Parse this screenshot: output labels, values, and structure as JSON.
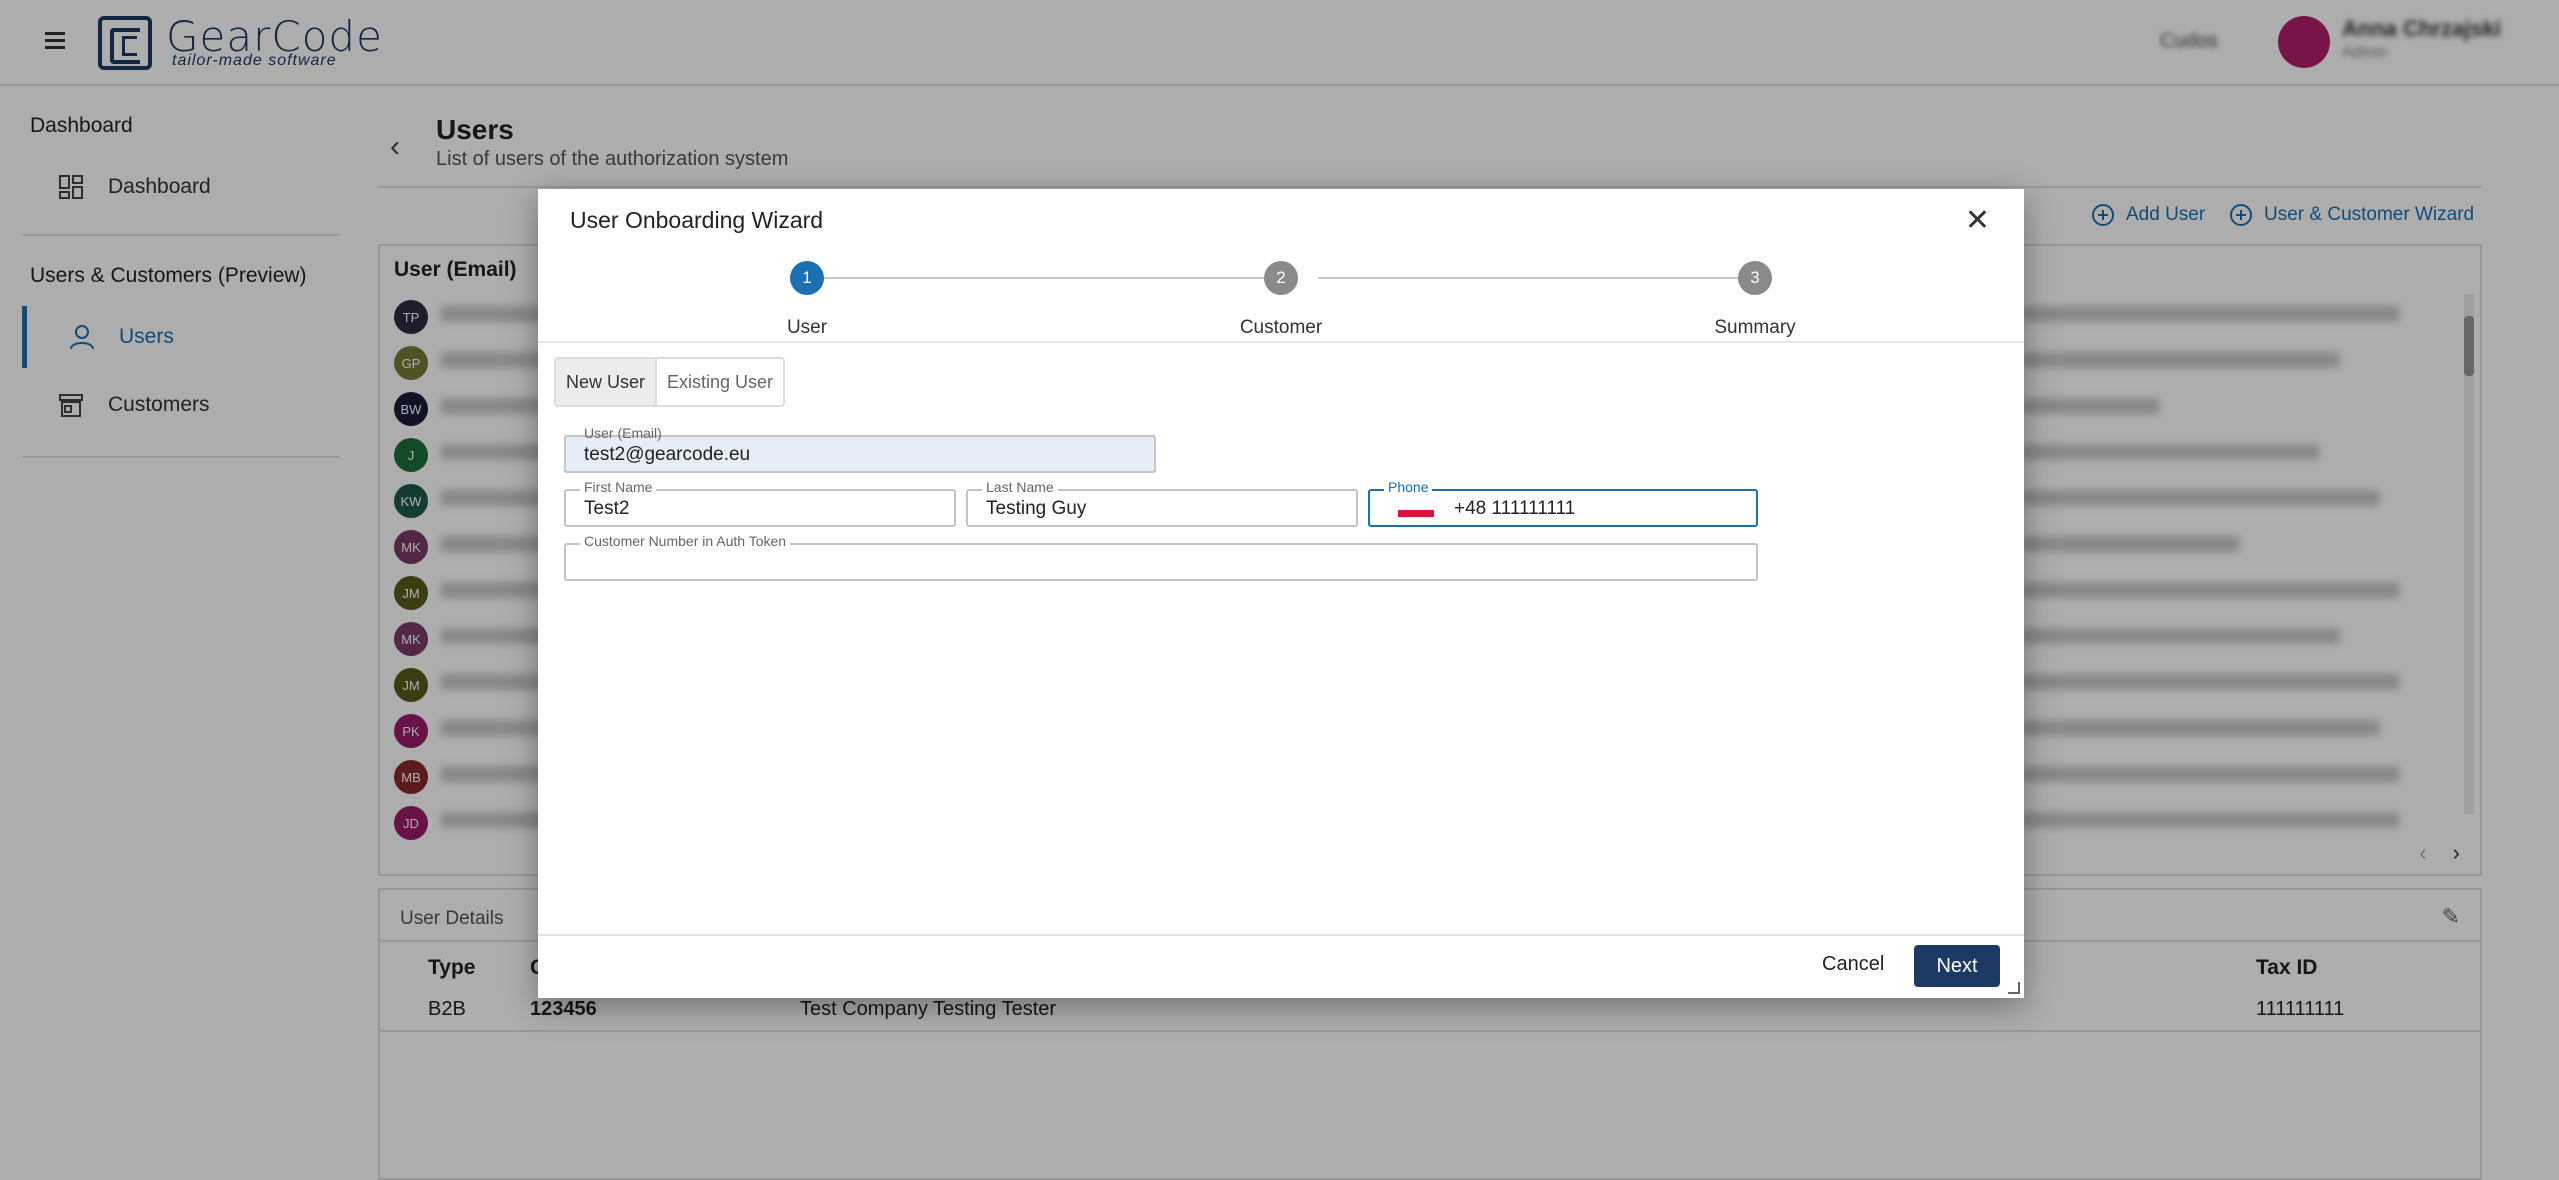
{
  "app": {
    "brand": "GearCode",
    "tagline": "tailor-made software"
  },
  "topbar": {
    "right_text": "Cudos",
    "user_name": "Anna Chrzajski",
    "user_sub": "Admin"
  },
  "sidebar": {
    "section1": "Dashboard",
    "item_dashboard": "Dashboard",
    "section2": "Users & Customers (Preview)",
    "item_users": "Users",
    "item_customers": "Customers"
  },
  "page": {
    "title": "Users",
    "subtitle": "List of users of the authorization system"
  },
  "actions": {
    "add_user": "Add User",
    "wizard": "User & Customer Wizard"
  },
  "table": {
    "header": "User (Email)",
    "avatars": [
      {
        "initials": "TP",
        "color": "#2c2c44"
      },
      {
        "initials": "GP",
        "color": "#7a7a3a"
      },
      {
        "initials": "BW",
        "color": "#1c1c3c"
      },
      {
        "initials": "J",
        "color": "#1c6e3a"
      },
      {
        "initials": "KW",
        "color": "#1c5a4a"
      },
      {
        "initials": "MK",
        "color": "#7a3a6a"
      },
      {
        "initials": "JM",
        "color": "#5a5a1c"
      },
      {
        "initials": "MK",
        "color": "#7a3a6a"
      },
      {
        "initials": "JM",
        "color": "#5a5a1c"
      },
      {
        "initials": "PK",
        "color": "#9a1c6a"
      },
      {
        "initials": "MB",
        "color": "#8a2a2a"
      },
      {
        "initials": "JD",
        "color": "#9a1c6a"
      }
    ]
  },
  "details": {
    "tab": "User Details",
    "columns": {
      "type": "Type",
      "code": "C",
      "tax": "Tax ID"
    },
    "row": {
      "type": "B2B",
      "code": "123456",
      "name": "Test Company Testing Tester",
      "tax": "111111111"
    }
  },
  "dialog": {
    "title": "User Onboarding Wizard",
    "steps": [
      {
        "num": "1",
        "label": "User"
      },
      {
        "num": "2",
        "label": "Customer"
      },
      {
        "num": "3",
        "label": "Summary"
      }
    ],
    "toggle": {
      "new": "New User",
      "existing": "Existing User"
    },
    "fields": {
      "email_label": "User (Email)",
      "email_value": "test2@gearcode.eu",
      "first_label": "First Name",
      "first_value": "Test2",
      "last_label": "Last Name",
      "last_value": "Testing Guy",
      "phone_label": "Phone",
      "phone_value": "+48 111111111",
      "custnum_label": "Customer Number in Auth Token",
      "custnum_value": ""
    },
    "cancel": "Cancel",
    "next": "Next"
  }
}
